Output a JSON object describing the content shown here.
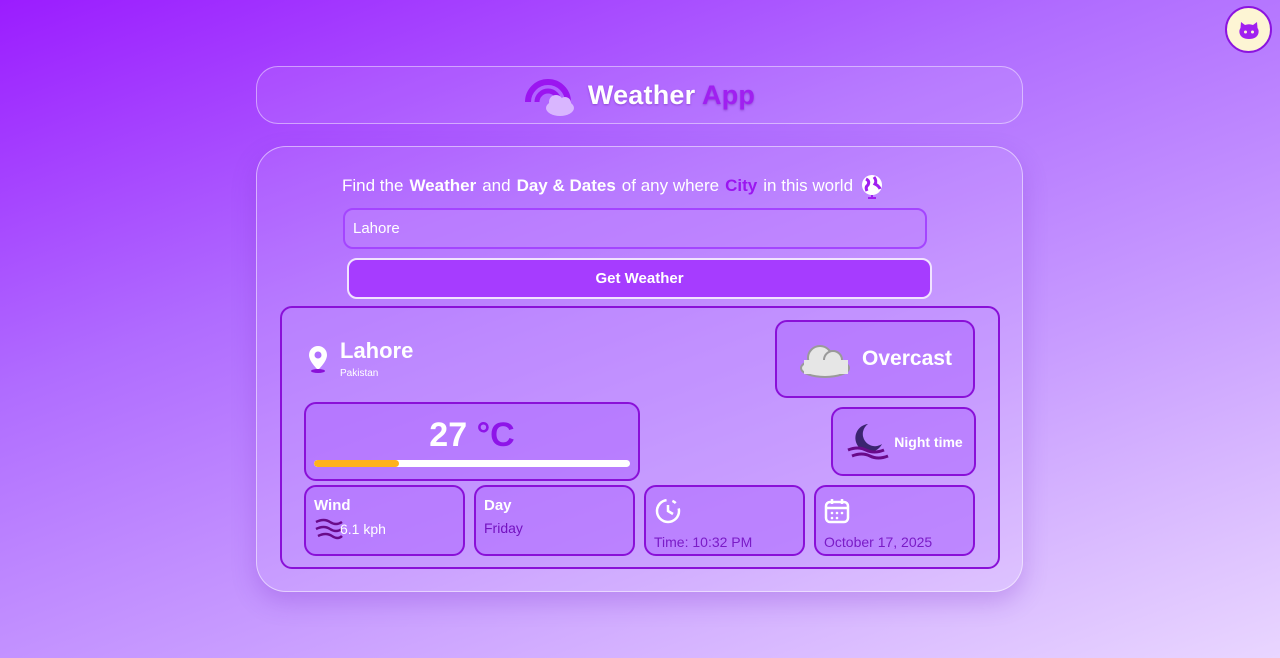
{
  "github": {
    "icon": "github-icon"
  },
  "header": {
    "title_main": "Weather",
    "title_accent": "App",
    "logo_icon": "rainbow-cloud-icon"
  },
  "tagline": {
    "t1": "Find the",
    "t2": "Weather",
    "t3": "and",
    "t4": "Day & Dates",
    "t5": "of any where",
    "t6": "City",
    "t7": "in this world",
    "icon": "globe-icon"
  },
  "search": {
    "value": "Lahore",
    "placeholder": ""
  },
  "button": {
    "label": "Get Weather"
  },
  "result": {
    "city": "Lahore",
    "country": "Pakistan",
    "condition": "Overcast",
    "temperature": "27",
    "unit": "°C",
    "temp_fraction": 0.27,
    "time_of_day": "Night time",
    "wind": {
      "label": "Wind",
      "value": "6.1 kph"
    },
    "day": {
      "label": "Day",
      "value": "Friday"
    },
    "time": {
      "value": "Time: 10:32 PM"
    },
    "date": {
      "value": "October 17, 2025"
    }
  },
  "colors": {
    "accent": "#a020f0",
    "bar_fill": "#ffb21c",
    "border": "#8a10d8"
  }
}
